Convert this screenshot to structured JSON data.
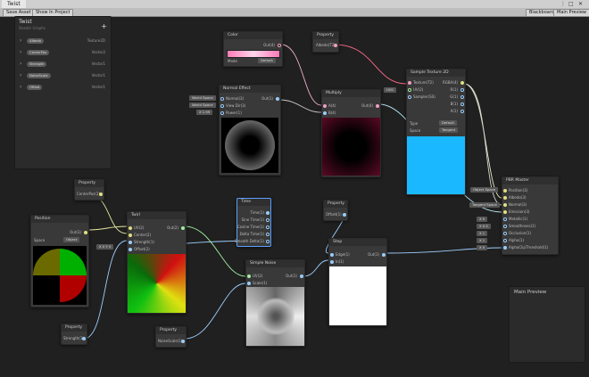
{
  "window": {
    "tab": "Twist",
    "controls": {
      "menu": "⋮",
      "max": "□",
      "close": "✕"
    }
  },
  "toolbar": {
    "save": "Save Asset",
    "show_in_project": "Show In Project",
    "blackboard": "Blackboard",
    "main_preview": "Main Preview"
  },
  "blackboard": {
    "title": "Twist",
    "subtitle": "Shader Graphs",
    "add": "+",
    "items": [
      {
        "name": "Albedo",
        "type": "Texture2D"
      },
      {
        "name": "CenterPos",
        "type": "Vector2"
      },
      {
        "name": "Strength",
        "type": "Vector1"
      },
      {
        "name": "NoiseScale",
        "type": "Vector1"
      },
      {
        "name": "Offset",
        "type": "Vector1"
      }
    ]
  },
  "nodes": {
    "color": {
      "title": "Color",
      "out": "Out(4)",
      "mode_label": "Mode",
      "mode": "Default"
    },
    "property_albedo": {
      "title": "Property",
      "out": "Albedo(T2)"
    },
    "sample_tex": {
      "title": "Sample Texture 2D",
      "inputs": [
        "Texture(T2)",
        "UV(2)",
        "Sampler(SS)"
      ],
      "outputs": [
        "RGBA(4)",
        "R(1)",
        "G(1)",
        "B(1)",
        "A(1)"
      ],
      "uv_field": "UV0",
      "type_label": "Type",
      "type_value": "Default",
      "space_label": "Space",
      "space_value": "Tangent"
    },
    "normal": {
      "title": "Normal Effect",
      "inputs": [
        "Normal(3)",
        "View Dir(3)",
        "Power(1)"
      ],
      "out": "Out(1)",
      "fields": [
        "World Space",
        "World Space",
        "X 1.99"
      ]
    },
    "multiply": {
      "title": "Multiply",
      "inputs": [
        "A(4)",
        "B(4)"
      ],
      "out": "Out(4)"
    },
    "pbr": {
      "title": "PBR Master",
      "inputs": [
        "Position(3)",
        "Albedo(3)",
        "Normal(3)",
        "Emission(3)",
        "Metallic(1)",
        "Smoothness(1)",
        "Occlusion(1)",
        "Alpha(1)",
        "AlphaClipThreshold(1)"
      ],
      "fields": [
        "Object Space",
        "Tangent Space",
        "X 0",
        "X 0.5",
        "X 1",
        "X 1",
        "X 0"
      ]
    },
    "property_center": {
      "title": "Property",
      "out": "CenterPos(2)"
    },
    "position": {
      "title": "Position",
      "out": "Out(3)",
      "space_label": "Space",
      "space_value": "Object"
    },
    "twirl": {
      "title": "Twirl",
      "inputs": [
        "UV(2)",
        "Center(2)",
        "Strength(1)",
        "Offset(2)"
      ],
      "out": "Out(2)",
      "field": "X 0 Y 0"
    },
    "property_strength": {
      "title": "Property",
      "out": "Strength(1)"
    },
    "time": {
      "title": "Time",
      "outputs": [
        "Time(1)",
        "Sine Time(1)",
        "Cosine Time(1)",
        "Delta Time(1)",
        "Smooth Delta(1)"
      ]
    },
    "property_offset": {
      "title": "Property",
      "out": "Offset(1)"
    },
    "simple_noise": {
      "title": "Simple Noise",
      "inputs": [
        "UV(2)",
        "Scale(1)"
      ],
      "out": "Out(1)"
    },
    "property_noise": {
      "title": "Property",
      "out": "NoiseScale(1)"
    },
    "step": {
      "title": "Step",
      "inputs": [
        "Edge(1)",
        "In(1)"
      ],
      "out": "Out(1)"
    }
  },
  "main_preview": {
    "title": "Main Preview"
  }
}
